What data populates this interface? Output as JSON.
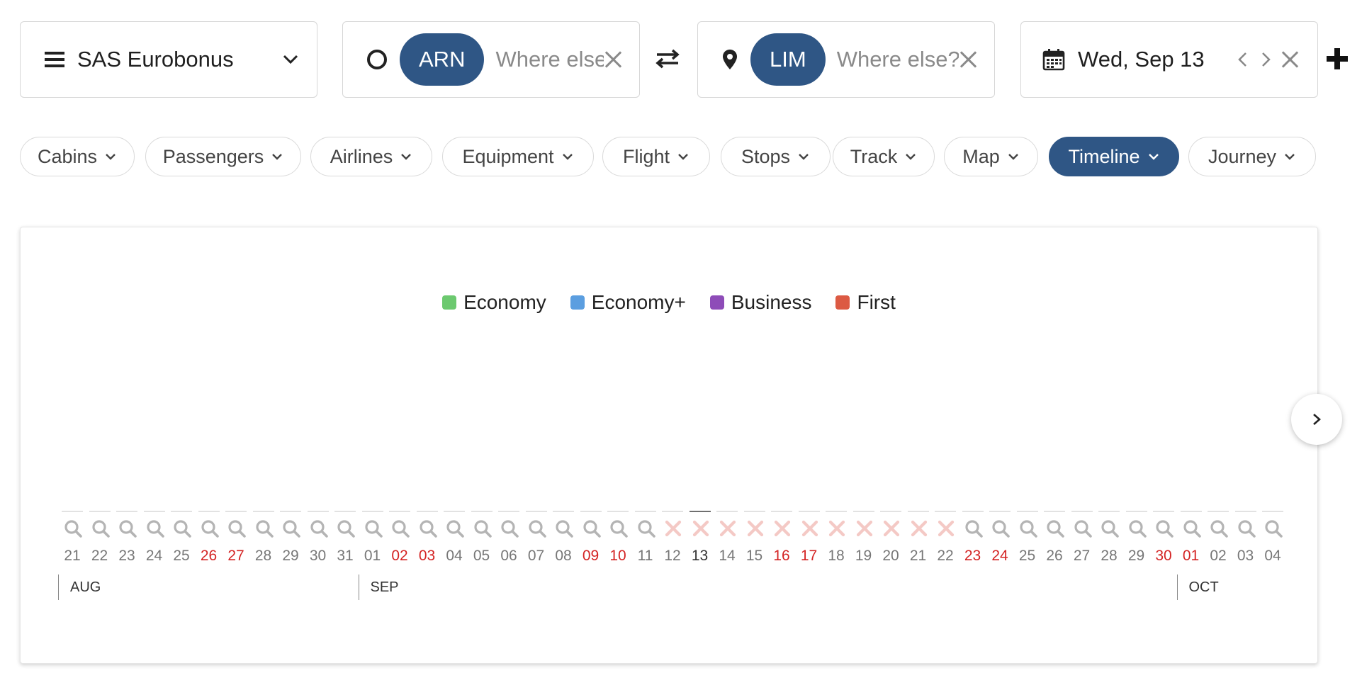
{
  "program": {
    "label": "SAS Eurobonus"
  },
  "origin": {
    "code": "ARN",
    "placeholder": "Where else?"
  },
  "destination": {
    "code": "LIM",
    "placeholder": "Where else?"
  },
  "date": {
    "label": "Wed, Sep 13"
  },
  "filters": [
    {
      "label": "Cabins",
      "active": false
    },
    {
      "label": "Passengers",
      "active": false
    },
    {
      "label": "Airlines",
      "active": false
    },
    {
      "label": "Equipment",
      "active": false
    },
    {
      "label": "Flight",
      "active": false
    },
    {
      "label": "Stops",
      "active": false
    },
    {
      "label": "Track",
      "active": false
    },
    {
      "label": "Map",
      "active": false
    },
    {
      "label": "Timeline",
      "active": true
    },
    {
      "label": "Journey",
      "active": false
    }
  ],
  "legend": [
    {
      "label": "Economy",
      "color": "#6cc96f"
    },
    {
      "label": "Economy+",
      "color": "#5b9ee0"
    },
    {
      "label": "Business",
      "color": "#8e4cb8"
    },
    {
      "label": "First",
      "color": "#dc5a43"
    }
  ],
  "timeline": {
    "days": [
      {
        "d": "21",
        "we": false,
        "st": "search"
      },
      {
        "d": "22",
        "we": false,
        "st": "search"
      },
      {
        "d": "23",
        "we": false,
        "st": "search"
      },
      {
        "d": "24",
        "we": false,
        "st": "search"
      },
      {
        "d": "25",
        "we": false,
        "st": "search"
      },
      {
        "d": "26",
        "we": true,
        "st": "search"
      },
      {
        "d": "27",
        "we": true,
        "st": "search"
      },
      {
        "d": "28",
        "we": false,
        "st": "search"
      },
      {
        "d": "29",
        "we": false,
        "st": "search"
      },
      {
        "d": "30",
        "we": false,
        "st": "search"
      },
      {
        "d": "31",
        "we": false,
        "st": "search"
      },
      {
        "d": "01",
        "we": false,
        "st": "search"
      },
      {
        "d": "02",
        "we": true,
        "st": "search"
      },
      {
        "d": "03",
        "we": true,
        "st": "search"
      },
      {
        "d": "04",
        "we": false,
        "st": "search"
      },
      {
        "d": "05",
        "we": false,
        "st": "search"
      },
      {
        "d": "06",
        "we": false,
        "st": "search"
      },
      {
        "d": "07",
        "we": false,
        "st": "search"
      },
      {
        "d": "08",
        "we": false,
        "st": "search"
      },
      {
        "d": "09",
        "we": true,
        "st": "search"
      },
      {
        "d": "10",
        "we": true,
        "st": "search"
      },
      {
        "d": "11",
        "we": false,
        "st": "search"
      },
      {
        "d": "12",
        "we": false,
        "st": "none"
      },
      {
        "d": "13",
        "we": false,
        "st": "none",
        "sel": true
      },
      {
        "d": "14",
        "we": false,
        "st": "none"
      },
      {
        "d": "15",
        "we": false,
        "st": "none"
      },
      {
        "d": "16",
        "we": true,
        "st": "none"
      },
      {
        "d": "17",
        "we": true,
        "st": "none"
      },
      {
        "d": "18",
        "we": false,
        "st": "none"
      },
      {
        "d": "19",
        "we": false,
        "st": "none"
      },
      {
        "d": "20",
        "we": false,
        "st": "none"
      },
      {
        "d": "21",
        "we": false,
        "st": "none"
      },
      {
        "d": "22",
        "we": false,
        "st": "none"
      },
      {
        "d": "23",
        "we": true,
        "st": "search"
      },
      {
        "d": "24",
        "we": true,
        "st": "search"
      },
      {
        "d": "25",
        "we": false,
        "st": "search"
      },
      {
        "d": "26",
        "we": false,
        "st": "search"
      },
      {
        "d": "27",
        "we": false,
        "st": "search"
      },
      {
        "d": "28",
        "we": false,
        "st": "search"
      },
      {
        "d": "29",
        "we": false,
        "st": "search"
      },
      {
        "d": "30",
        "we": true,
        "st": "search"
      },
      {
        "d": "01",
        "we": true,
        "st": "search"
      },
      {
        "d": "02",
        "we": false,
        "st": "search"
      },
      {
        "d": "03",
        "we": false,
        "st": "search"
      },
      {
        "d": "04",
        "we": false,
        "st": "search"
      }
    ],
    "months": [
      {
        "label": "AUG",
        "start": 0
      },
      {
        "label": "SEP",
        "start": 11
      },
      {
        "label": "OCT",
        "start": 41
      }
    ]
  }
}
